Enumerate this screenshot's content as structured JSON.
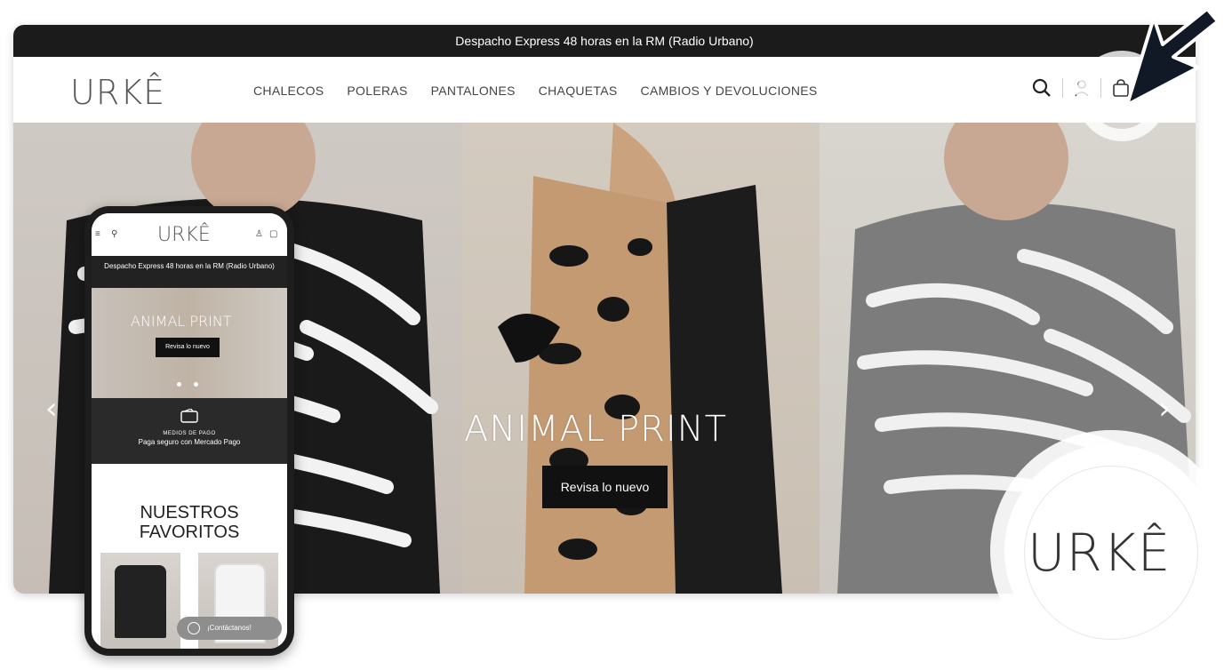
{
  "desktop": {
    "announcement": "Despacho Express 48 horas en la RM (Radio Urbano)",
    "logo": "URKÊ",
    "nav": [
      "CHALECOS",
      "POLERAS",
      "PANTALONES",
      "CHAQUETAS",
      "CAMBIOS Y DEVOLUCIONES"
    ],
    "icons": [
      "search-icon",
      "user-icon",
      "bag-icon"
    ],
    "hero": {
      "title": "ANIMAL PRINT",
      "button": "Revisa lo nuevo"
    }
  },
  "mobile": {
    "logo": "URKÊ",
    "announcement": "Despacho Express 48 horas en la RM (Radio Urbano)",
    "hero_title": "ANIMAL PRINT",
    "hero_button": "Revisa lo nuevo",
    "payment_title": "MEDIOS DE PAGO",
    "payment_text": "Paga seguro con Mercado Pago",
    "favorites_title": "NUESTROS FAVORITOS",
    "contact_button": "¡Contáctanos!"
  },
  "badge": {
    "logo": "URKÊ"
  }
}
